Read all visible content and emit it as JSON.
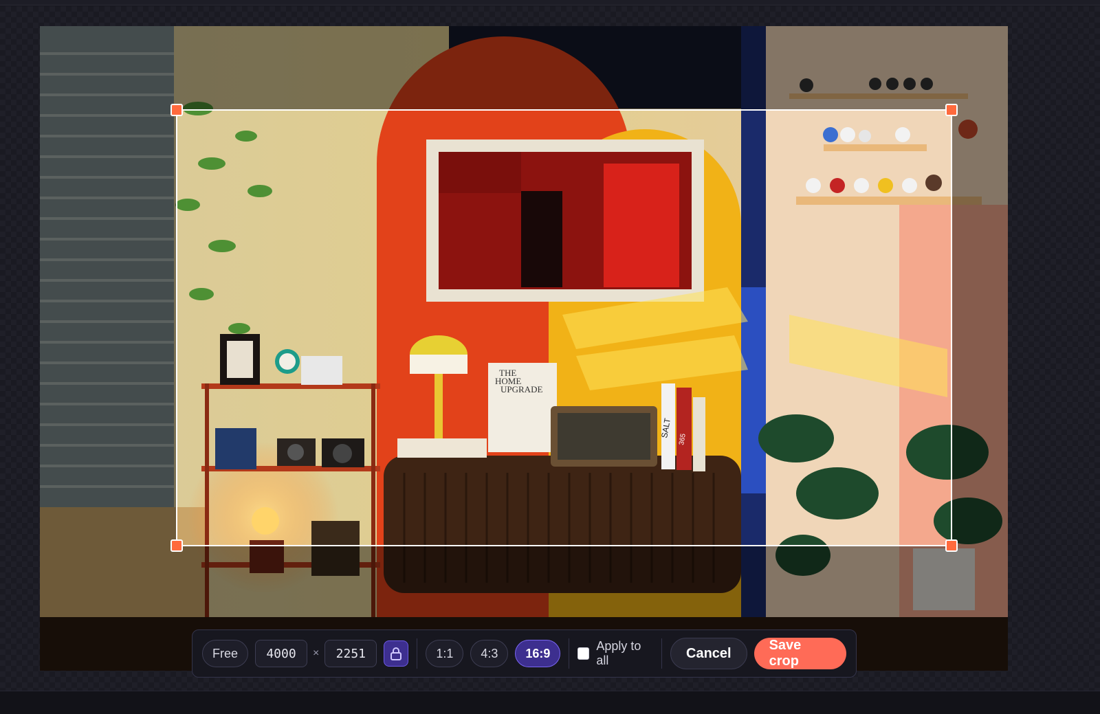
{
  "toolbar": {
    "free_label": "Free",
    "width_value": "4000",
    "times_symbol": "×",
    "height_value": "2251",
    "lock_icon": "lock-icon",
    "ratios": [
      {
        "label": "1:1",
        "active": false
      },
      {
        "label": "4:3",
        "active": false
      },
      {
        "label": "16:9",
        "active": true
      }
    ],
    "apply_all_label": "Apply to all",
    "apply_all_checked": false,
    "cancel_label": "Cancel",
    "save_label": "Save crop"
  },
  "colors": {
    "accent": "#ff6b57",
    "handle": "#ff6a3d",
    "active_ratio": "#3d2f8f",
    "active_ratio_border": "#7a66f2"
  },
  "photo": {
    "book_text_1": "THE",
    "book_text_2": "HOME",
    "book_text_3": "UPGRADE",
    "spine_text_1": "SALT",
    "spine_text_2": "365"
  }
}
